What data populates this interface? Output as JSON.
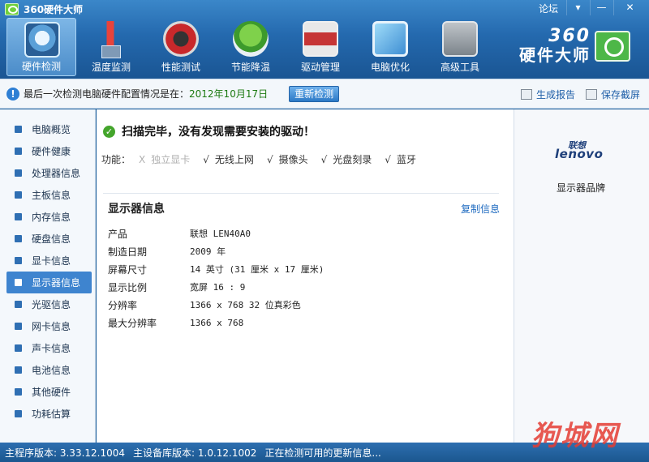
{
  "window": {
    "title": "360硬件大师",
    "forum": "论坛",
    "menu_btn": "▾",
    "min_btn": "—",
    "close_btn": "✕"
  },
  "toolbar": {
    "items": [
      {
        "label": "硬件检测",
        "icon": "hardware-check-icon",
        "active": true
      },
      {
        "label": "温度监测",
        "icon": "thermometer-icon"
      },
      {
        "label": "性能测试",
        "icon": "speedometer-icon"
      },
      {
        "label": "节能降温",
        "icon": "clover-icon"
      },
      {
        "label": "驱动管理",
        "icon": "driver-box-icon"
      },
      {
        "label": "电脑优化",
        "icon": "monitor-optimize-icon"
      },
      {
        "label": "高级工具",
        "icon": "toolbox-icon"
      }
    ]
  },
  "brand": {
    "number": "360",
    "name": "硬件大师"
  },
  "infobar": {
    "text": "最后一次检测电脑硬件配置情况是在：",
    "date": "2012年10月17日",
    "recheck": "重新检测",
    "report": "生成报告",
    "screenshot": "保存截屏"
  },
  "sidebar": {
    "items": [
      {
        "label": "电脑概览"
      },
      {
        "label": "硬件健康"
      },
      {
        "label": "处理器信息"
      },
      {
        "label": "主板信息"
      },
      {
        "label": "内存信息"
      },
      {
        "label": "硬盘信息"
      },
      {
        "label": "显卡信息"
      },
      {
        "label": "显示器信息",
        "active": true
      },
      {
        "label": "光驱信息"
      },
      {
        "label": "网卡信息"
      },
      {
        "label": "声卡信息"
      },
      {
        "label": "电池信息"
      },
      {
        "label": "其他硬件"
      },
      {
        "label": "功耗估算"
      }
    ]
  },
  "main": {
    "scan_status": "扫描完毕，没有发现需要安装的驱动！",
    "func_label": "功能：",
    "functions": [
      {
        "mark": "X",
        "label": "独立显卡",
        "enabled": false
      },
      {
        "mark": "√",
        "label": "无线上网",
        "enabled": true
      },
      {
        "mark": "√",
        "label": "摄像头",
        "enabled": true
      },
      {
        "mark": "√",
        "label": "光盘刻录",
        "enabled": true
      },
      {
        "mark": "√",
        "label": "蓝牙",
        "enabled": true
      }
    ],
    "section_title": "显示器信息",
    "copy": "复制信息",
    "rows": [
      {
        "key": "产品",
        "value": "联想 LEN40A0"
      },
      {
        "key": "制造日期",
        "value": "2009 年"
      },
      {
        "key": "屏幕尺寸",
        "value": "14 英寸 (31 厘米 x 17 厘米)"
      },
      {
        "key": "显示比例",
        "value": "宽屏 16 : 9"
      },
      {
        "key": "分辨率",
        "value": "1366 x 768 32 位真彩色"
      },
      {
        "key": "最大分辨率",
        "value": "1366 x 768"
      }
    ]
  },
  "right_panel": {
    "logo_cn": "联想",
    "logo_en": "lenovo",
    "caption": "显示器品牌"
  },
  "statusbar": {
    "main_version": "主程序版本: 3.33.12.1004",
    "db_version": "主设备库版本: 1.0.12.1002",
    "update_msg": "正在检测可用的更新信息..."
  },
  "watermark": "狗城网",
  "colors": {
    "title_bar": "#2469ae",
    "accent_blue": "#3e84cf",
    "success_green": "#44a52c",
    "date_green": "#1d7a12",
    "link_blue": "#1f6bc0"
  }
}
